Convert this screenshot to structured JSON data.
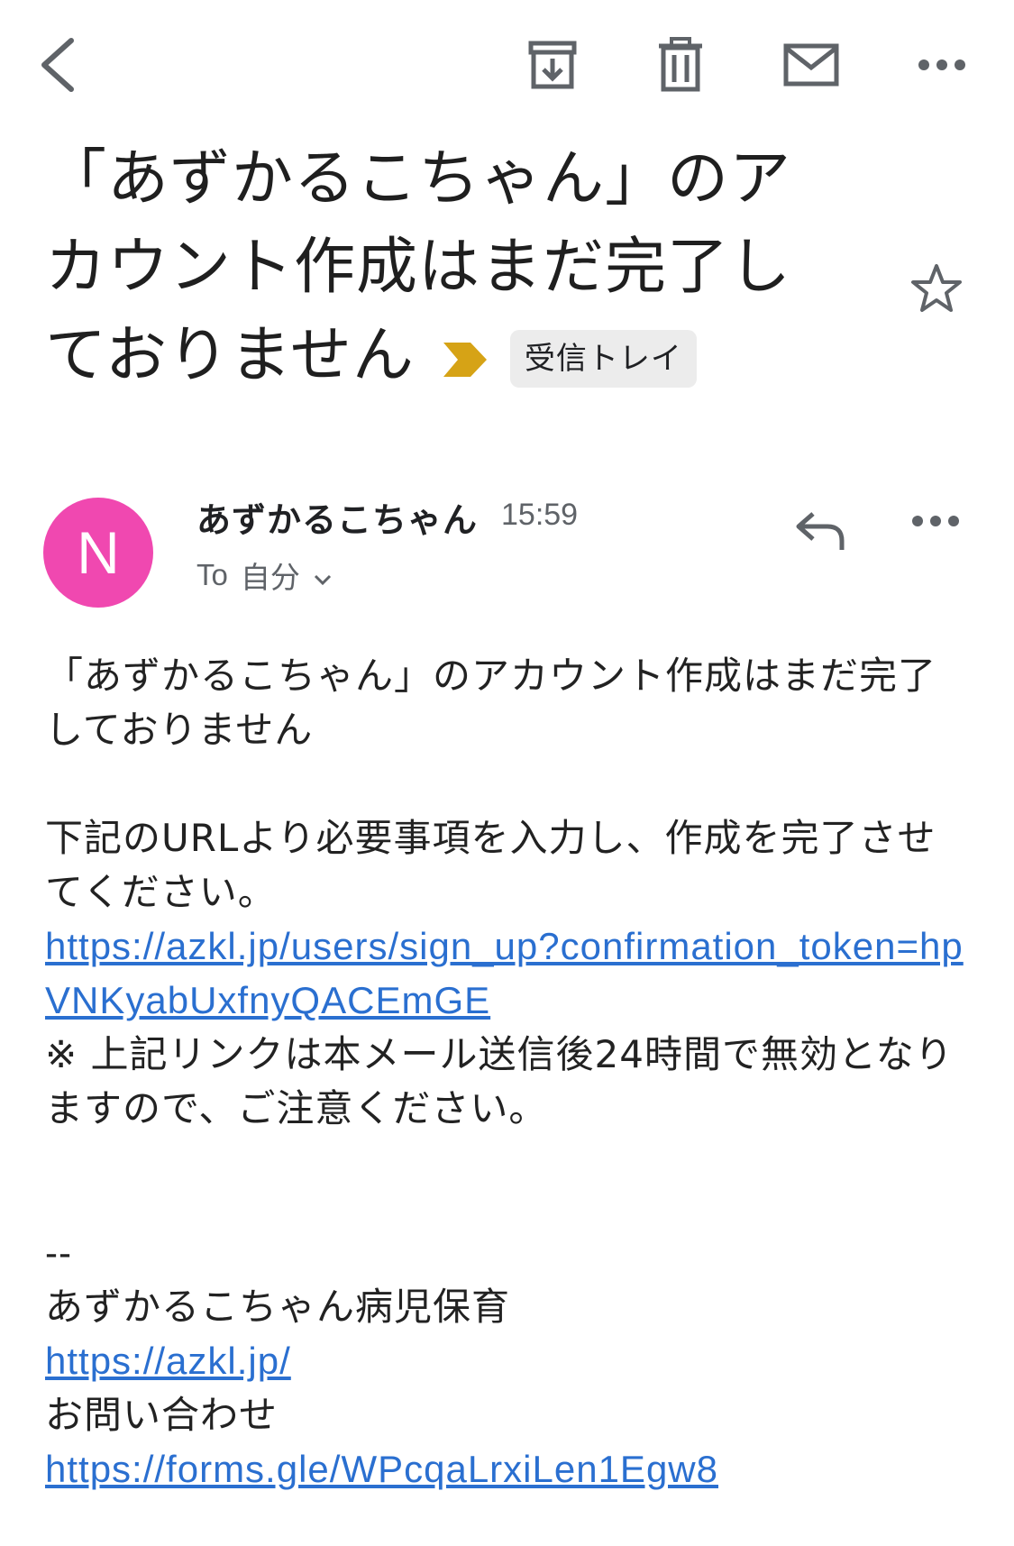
{
  "toolbar": {
    "back_icon": "chevron-left-icon",
    "archive_icon": "archive-icon",
    "delete_icon": "trash-icon",
    "mark_unread_icon": "mail-icon",
    "more_icon": "more-horizontal-icon"
  },
  "subject": {
    "title": "「あずかるこちゃん」のアカウント作成はまだ完了しておりません",
    "label": "受信トレイ",
    "important_color": "#d6a316"
  },
  "sender": {
    "avatar_letter": "N",
    "avatar_color": "#f048b0",
    "name": "あずかるこちゃん",
    "time": "15:59",
    "to_label": "To",
    "recipient": "自分"
  },
  "body": {
    "line1": "「あずかるこちゃん」のアカウント作成はまだ完了しておりません",
    "line2": "下記のURLより必要事項を入力し、作成を完了させてください。",
    "signup_link": "https://azkl.jp/users/sign_up?confirmation_token=hpVNKyabUxfnyQACEmGE",
    "note": "※ 上記リンクは本メール送信後24時間で無効となりますので、ご注意ください。",
    "signature_sep": "--",
    "org_name": "あずかるこちゃん病児保育",
    "site_link": "https://azkl.jp/",
    "contact_label": "お問い合わせ",
    "form_link": "https://forms.gle/WPcqaLrxiLen1Egw8",
    "link_color": "#2a6fd0"
  }
}
